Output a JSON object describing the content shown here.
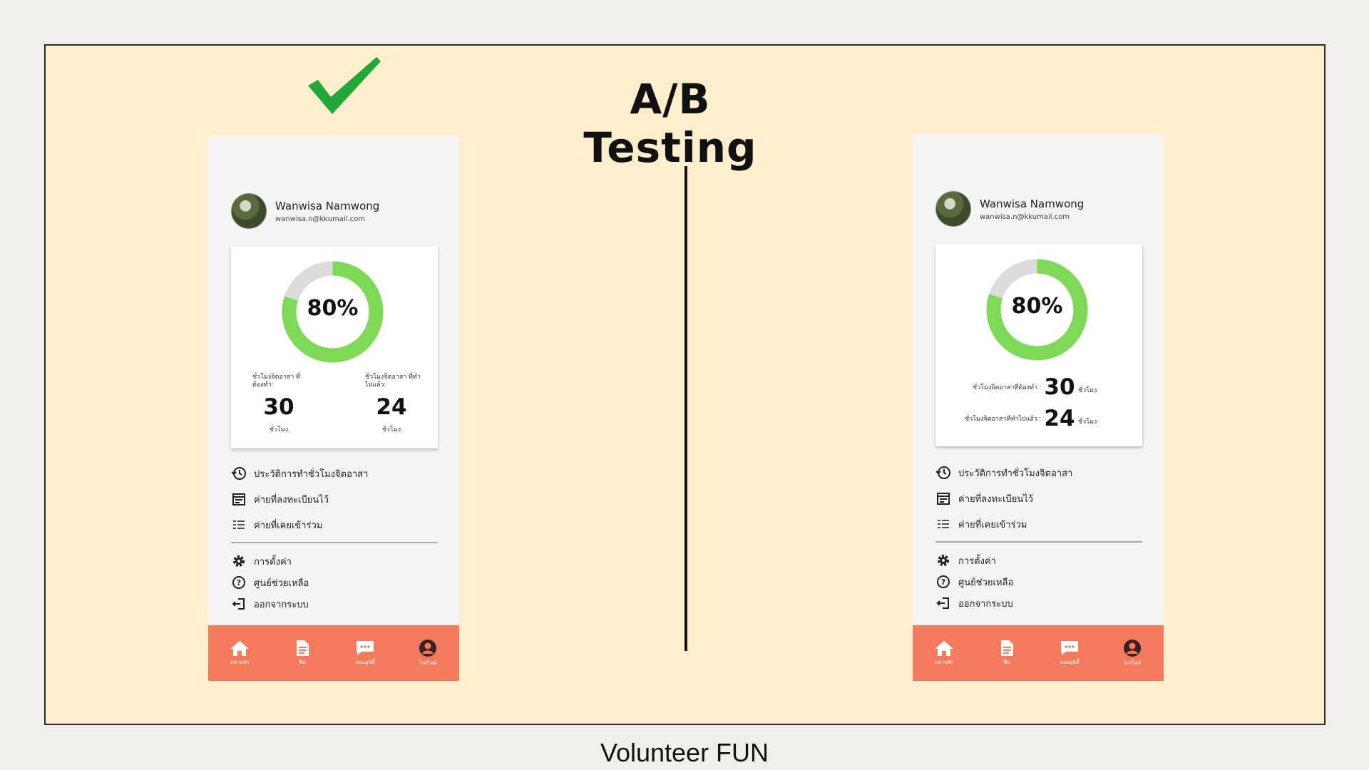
{
  "slide": {
    "title": "A/B Testing",
    "footer": "Volunteer FUN"
  },
  "colors": {
    "background": "#fdeecd",
    "accent_green": "#7ed957",
    "nav_orange": "#f47a5d",
    "check_green": "#22a83a"
  },
  "phone_a": {
    "user": {
      "name": "Wanwisa Namwong",
      "email": "wanwisa.n@kkumail.com"
    },
    "progress": {
      "percent_label": "80%",
      "value": 0.8
    },
    "stats": [
      {
        "label": "ชั่วโมงจิตอาสา ที่ต้องทำ:",
        "value": "30",
        "unit": "ชั่วโมง"
      },
      {
        "label": "ชั่วโมงจิตอาสา ที่ทำไปแล้ว:",
        "value": "24",
        "unit": "ชั่วโมง"
      }
    ],
    "menu": [
      {
        "label": "ประวัติการทำชั่วโมงจิตอาสา",
        "icon": "history-icon"
      },
      {
        "label": "ค่ายที่ลงทะเบียนไว้",
        "icon": "calendar-icon"
      },
      {
        "label": "ค่ายที่เคยเข้าร่วม",
        "icon": "list-icon"
      }
    ],
    "menu2": [
      {
        "label": "การตั้งค่า",
        "icon": "gear-icon"
      },
      {
        "label": "ศูนย์ช่วยเหลือ",
        "icon": "help-icon"
      },
      {
        "label": "ออกจากระบบ",
        "icon": "logout-icon"
      }
    ],
    "nav": [
      {
        "label": "หน้าหลัก",
        "icon": "home-icon"
      },
      {
        "label": "ฟีด",
        "icon": "document-icon"
      },
      {
        "label": "คอมมูนิตี้",
        "icon": "chat-icon"
      },
      {
        "label": "โปรไฟล์",
        "icon": "profile-icon"
      }
    ]
  },
  "phone_b": {
    "user": {
      "name": "Wanwisa Namwong",
      "email": "wanwisa.n@kkumail.com"
    },
    "progress": {
      "percent_label": "80%",
      "value": 0.8
    },
    "stats": [
      {
        "label": "ชั่วโมงจิตอาสาที่ต้องทำ :",
        "value": "30",
        "unit": "ชั่วโมง"
      },
      {
        "label": "ชั่วโมงจิตอาสาที่ทำไปแล้ว :",
        "value": "24",
        "unit": "ชั่วโมง"
      }
    ],
    "menu": [
      {
        "label": "ประวัติการทำชั่วโมงจิตอาสา",
        "icon": "history-icon"
      },
      {
        "label": "ค่ายที่ลงทะเบียนไว้",
        "icon": "calendar-icon"
      },
      {
        "label": "ค่ายที่เคยเข้าร่วม",
        "icon": "list-icon"
      }
    ],
    "menu2": [
      {
        "label": "การตั้งค่า",
        "icon": "gear-icon"
      },
      {
        "label": "ศูนย์ช่วยเหลือ",
        "icon": "help-icon"
      },
      {
        "label": "ออกจากระบบ",
        "icon": "logout-icon"
      }
    ],
    "nav": [
      {
        "label": "หน้าหลัก",
        "icon": "home-icon"
      },
      {
        "label": "ฟีด",
        "icon": "document-icon"
      },
      {
        "label": "คอมมูนิตี้",
        "icon": "chat-icon"
      },
      {
        "label": "โปรไฟล์",
        "icon": "profile-icon"
      }
    ]
  }
}
